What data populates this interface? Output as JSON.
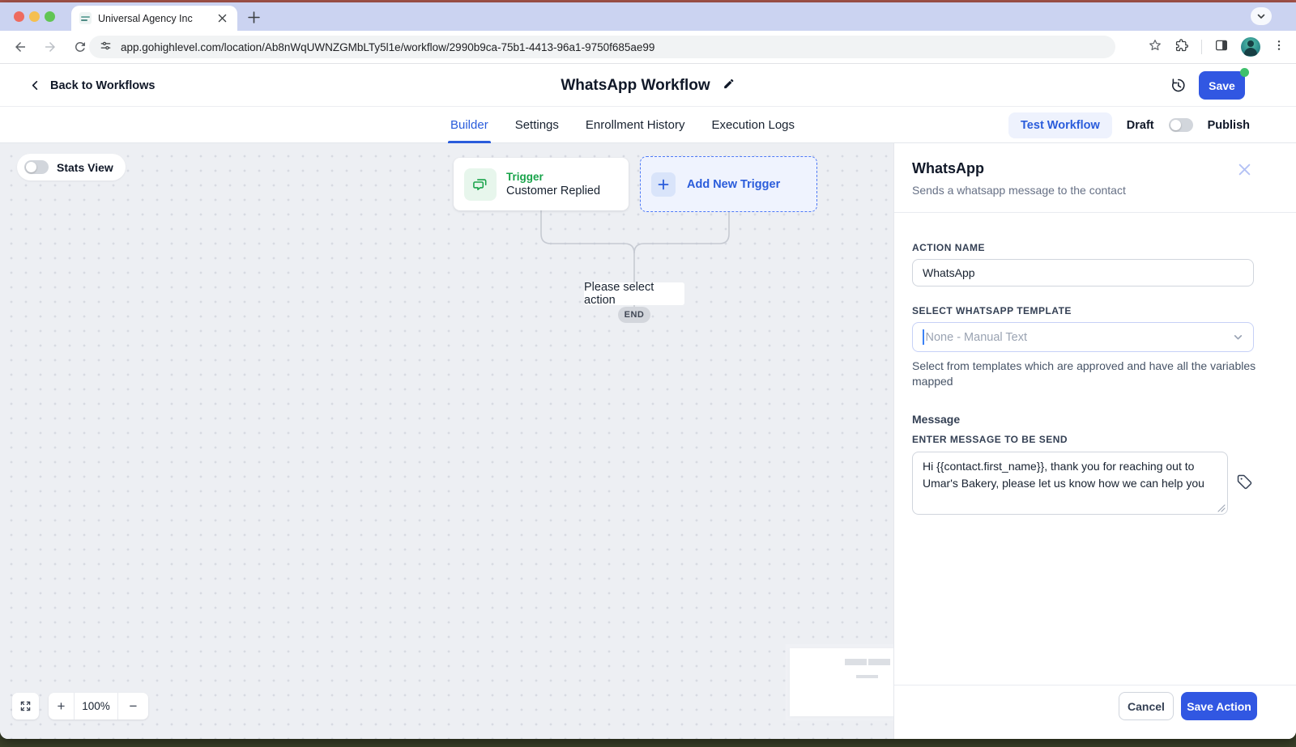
{
  "colors": {
    "primary_blue": "#3157e2",
    "link_blue": "#2a5cdb",
    "trigger_green": "#18a34a",
    "panel_close_icon": "#b4c2f5",
    "canvas_bg": "#edeff3",
    "tabstrip_bg": "#cbd3f1",
    "save_status_dot": "#3fc06c"
  },
  "browser": {
    "tab_title": "Universal Agency Inc",
    "url": "app.gohighlevel.com/location/Ab8nWqUWNZGMbLTy5l1e/workflow/2990b9ca-75b1-4413-96a1-9750f685ae99"
  },
  "header": {
    "back_label": "Back to Workflows",
    "title": "WhatsApp Workflow",
    "save_label": "Save"
  },
  "nav": {
    "tabs": [
      {
        "label": "Builder",
        "active": true
      },
      {
        "label": "Settings",
        "active": false
      },
      {
        "label": "Enrollment History",
        "active": false
      },
      {
        "label": "Execution Logs",
        "active": false
      }
    ],
    "test_workflow_label": "Test Workflow",
    "draft_label": "Draft",
    "publish_label": "Publish"
  },
  "canvas": {
    "stats_view_label": "Stats View",
    "trigger_card": {
      "title": "Trigger",
      "subtitle": "Customer Replied"
    },
    "add_trigger_label": "Add New Trigger",
    "select_action_label": "Please select action",
    "end_label": "END",
    "zoom_level": "100%",
    "zoom_in": "+",
    "zoom_out": "−"
  },
  "panel": {
    "title": "WhatsApp",
    "subtitle": "Sends a whatsapp message to the contact",
    "action_name_label": "ACTION NAME",
    "action_name_value": "WhatsApp",
    "template_label": "SELECT WHATSAPP TEMPLATE",
    "template_placeholder": "None - Manual Text",
    "template_help": "Select from templates which are approved and have all the variables mapped",
    "message_section_label": "Message",
    "message_field_label": "ENTER MESSAGE TO BE SEND",
    "message_value": "Hi {{contact.first_name}}, thank you for reaching out to Umar's Bakery, please let us know how we can help you",
    "cancel_label": "Cancel",
    "save_action_label": "Save Action"
  }
}
